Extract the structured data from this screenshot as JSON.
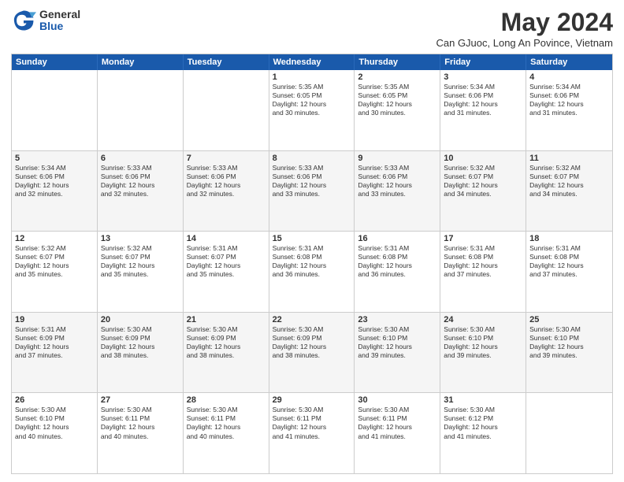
{
  "logo": {
    "general": "General",
    "blue": "Blue"
  },
  "title": "May 2024",
  "subtitle": "Can GJuoc, Long An Povince, Vietnam",
  "days": [
    "Sunday",
    "Monday",
    "Tuesday",
    "Wednesday",
    "Thursday",
    "Friday",
    "Saturday"
  ],
  "rows": [
    {
      "alt": false,
      "cells": [
        {
          "day": "",
          "lines": []
        },
        {
          "day": "",
          "lines": []
        },
        {
          "day": "",
          "lines": []
        },
        {
          "day": "1",
          "lines": [
            "Sunrise: 5:35 AM",
            "Sunset: 6:05 PM",
            "Daylight: 12 hours",
            "and 30 minutes."
          ]
        },
        {
          "day": "2",
          "lines": [
            "Sunrise: 5:35 AM",
            "Sunset: 6:05 PM",
            "Daylight: 12 hours",
            "and 30 minutes."
          ]
        },
        {
          "day": "3",
          "lines": [
            "Sunrise: 5:34 AM",
            "Sunset: 6:06 PM",
            "Daylight: 12 hours",
            "and 31 minutes."
          ]
        },
        {
          "day": "4",
          "lines": [
            "Sunrise: 5:34 AM",
            "Sunset: 6:06 PM",
            "Daylight: 12 hours",
            "and 31 minutes."
          ]
        }
      ]
    },
    {
      "alt": true,
      "cells": [
        {
          "day": "5",
          "lines": [
            "Sunrise: 5:34 AM",
            "Sunset: 6:06 PM",
            "Daylight: 12 hours",
            "and 32 minutes."
          ]
        },
        {
          "day": "6",
          "lines": [
            "Sunrise: 5:33 AM",
            "Sunset: 6:06 PM",
            "Daylight: 12 hours",
            "and 32 minutes."
          ]
        },
        {
          "day": "7",
          "lines": [
            "Sunrise: 5:33 AM",
            "Sunset: 6:06 PM",
            "Daylight: 12 hours",
            "and 32 minutes."
          ]
        },
        {
          "day": "8",
          "lines": [
            "Sunrise: 5:33 AM",
            "Sunset: 6:06 PM",
            "Daylight: 12 hours",
            "and 33 minutes."
          ]
        },
        {
          "day": "9",
          "lines": [
            "Sunrise: 5:33 AM",
            "Sunset: 6:06 PM",
            "Daylight: 12 hours",
            "and 33 minutes."
          ]
        },
        {
          "day": "10",
          "lines": [
            "Sunrise: 5:32 AM",
            "Sunset: 6:07 PM",
            "Daylight: 12 hours",
            "and 34 minutes."
          ]
        },
        {
          "day": "11",
          "lines": [
            "Sunrise: 5:32 AM",
            "Sunset: 6:07 PM",
            "Daylight: 12 hours",
            "and 34 minutes."
          ]
        }
      ]
    },
    {
      "alt": false,
      "cells": [
        {
          "day": "12",
          "lines": [
            "Sunrise: 5:32 AM",
            "Sunset: 6:07 PM",
            "Daylight: 12 hours",
            "and 35 minutes."
          ]
        },
        {
          "day": "13",
          "lines": [
            "Sunrise: 5:32 AM",
            "Sunset: 6:07 PM",
            "Daylight: 12 hours",
            "and 35 minutes."
          ]
        },
        {
          "day": "14",
          "lines": [
            "Sunrise: 5:31 AM",
            "Sunset: 6:07 PM",
            "Daylight: 12 hours",
            "and 35 minutes."
          ]
        },
        {
          "day": "15",
          "lines": [
            "Sunrise: 5:31 AM",
            "Sunset: 6:08 PM",
            "Daylight: 12 hours",
            "and 36 minutes."
          ]
        },
        {
          "day": "16",
          "lines": [
            "Sunrise: 5:31 AM",
            "Sunset: 6:08 PM",
            "Daylight: 12 hours",
            "and 36 minutes."
          ]
        },
        {
          "day": "17",
          "lines": [
            "Sunrise: 5:31 AM",
            "Sunset: 6:08 PM",
            "Daylight: 12 hours",
            "and 37 minutes."
          ]
        },
        {
          "day": "18",
          "lines": [
            "Sunrise: 5:31 AM",
            "Sunset: 6:08 PM",
            "Daylight: 12 hours",
            "and 37 minutes."
          ]
        }
      ]
    },
    {
      "alt": true,
      "cells": [
        {
          "day": "19",
          "lines": [
            "Sunrise: 5:31 AM",
            "Sunset: 6:09 PM",
            "Daylight: 12 hours",
            "and 37 minutes."
          ]
        },
        {
          "day": "20",
          "lines": [
            "Sunrise: 5:30 AM",
            "Sunset: 6:09 PM",
            "Daylight: 12 hours",
            "and 38 minutes."
          ]
        },
        {
          "day": "21",
          "lines": [
            "Sunrise: 5:30 AM",
            "Sunset: 6:09 PM",
            "Daylight: 12 hours",
            "and 38 minutes."
          ]
        },
        {
          "day": "22",
          "lines": [
            "Sunrise: 5:30 AM",
            "Sunset: 6:09 PM",
            "Daylight: 12 hours",
            "and 38 minutes."
          ]
        },
        {
          "day": "23",
          "lines": [
            "Sunrise: 5:30 AM",
            "Sunset: 6:10 PM",
            "Daylight: 12 hours",
            "and 39 minutes."
          ]
        },
        {
          "day": "24",
          "lines": [
            "Sunrise: 5:30 AM",
            "Sunset: 6:10 PM",
            "Daylight: 12 hours",
            "and 39 minutes."
          ]
        },
        {
          "day": "25",
          "lines": [
            "Sunrise: 5:30 AM",
            "Sunset: 6:10 PM",
            "Daylight: 12 hours",
            "and 39 minutes."
          ]
        }
      ]
    },
    {
      "alt": false,
      "cells": [
        {
          "day": "26",
          "lines": [
            "Sunrise: 5:30 AM",
            "Sunset: 6:10 PM",
            "Daylight: 12 hours",
            "and 40 minutes."
          ]
        },
        {
          "day": "27",
          "lines": [
            "Sunrise: 5:30 AM",
            "Sunset: 6:11 PM",
            "Daylight: 12 hours",
            "and 40 minutes."
          ]
        },
        {
          "day": "28",
          "lines": [
            "Sunrise: 5:30 AM",
            "Sunset: 6:11 PM",
            "Daylight: 12 hours",
            "and 40 minutes."
          ]
        },
        {
          "day": "29",
          "lines": [
            "Sunrise: 5:30 AM",
            "Sunset: 6:11 PM",
            "Daylight: 12 hours",
            "and 41 minutes."
          ]
        },
        {
          "day": "30",
          "lines": [
            "Sunrise: 5:30 AM",
            "Sunset: 6:11 PM",
            "Daylight: 12 hours",
            "and 41 minutes."
          ]
        },
        {
          "day": "31",
          "lines": [
            "Sunrise: 5:30 AM",
            "Sunset: 6:12 PM",
            "Daylight: 12 hours",
            "and 41 minutes."
          ]
        },
        {
          "day": "",
          "lines": []
        }
      ]
    }
  ]
}
